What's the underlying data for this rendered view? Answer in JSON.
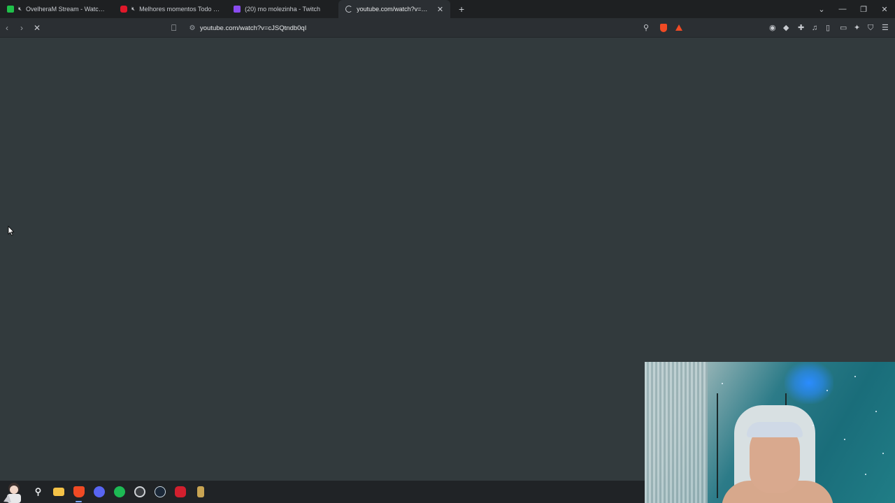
{
  "tabs": [
    {
      "title": "OvelheraM Stream - Watch Live o",
      "favicon": "kick-icon",
      "muted": true,
      "active": false
    },
    {
      "title": "Melhores momentos Todo Duro",
      "favicon": "youtube-icon",
      "muted": true,
      "active": false
    },
    {
      "title": "(20) mo molezinha - Twitch",
      "favicon": "twitch-icon",
      "muted": false,
      "active": false
    },
    {
      "title": "youtube.com/watch?v=cJSQtndb",
      "favicon": "loading-icon",
      "muted": false,
      "active": true
    }
  ],
  "address_bar": {
    "url": "youtube.com/watch?v=cJSQtndb0qI"
  },
  "taskbar": {
    "items": [
      "search-icon",
      "file-explorer-icon",
      "brave-browser-icon",
      "discord-icon",
      "spotify-icon",
      "obs-icon",
      "steam-icon",
      "app-icon",
      "lol-icon"
    ],
    "active": "brave-browser-icon"
  },
  "colors": {
    "page_bg": "#323a3d",
    "chrome_bg": "#1e2022",
    "toolbar_bg": "#2b2f33"
  }
}
